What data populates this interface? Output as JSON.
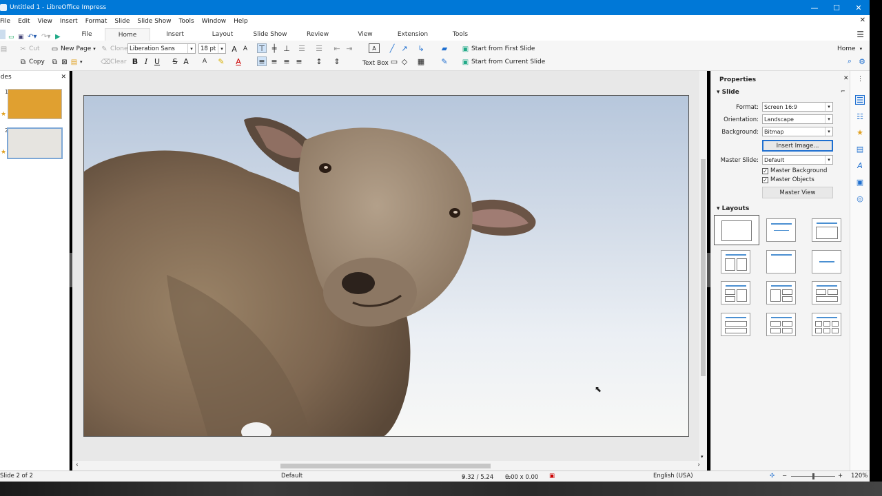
{
  "window": {
    "title": "Untitled 1 - LibreOffice Impress",
    "min": "—",
    "max": "☐",
    "close": "✕"
  },
  "menu": [
    "File",
    "Edit",
    "View",
    "Insert",
    "Format",
    "Slide",
    "Slide Show",
    "Tools",
    "Window",
    "Help"
  ],
  "menu_close": "✕",
  "tabs": [
    {
      "label": "File"
    },
    {
      "label": "Home"
    },
    {
      "label": "Insert"
    },
    {
      "label": "Layout"
    },
    {
      "label": "Slide Show"
    },
    {
      "label": "Review"
    },
    {
      "label": "View"
    },
    {
      "label": "Extension"
    },
    {
      "label": "Tools"
    }
  ],
  "toolbar": {
    "cut": "Cut",
    "copy": "Copy",
    "new_page": "New Page",
    "clone": "Clone",
    "clear": "Clear",
    "font_name": "Liberation Sans",
    "font_size": "18 pt",
    "text_box": "Text Box",
    "start_first": "Start from First Slide",
    "start_current": "Start from Current Slide",
    "home_dd": "Home",
    "bold": "B",
    "italic": "I",
    "underline": "U",
    "strike": "S",
    "shadow": "A",
    "font_color": "A",
    "grow": "A",
    "shrink": "A",
    "case": "A"
  },
  "slides_pane": {
    "title": "Slides",
    "items": [
      {
        "num": "1",
        "color": "#e0a030"
      },
      {
        "num": "2",
        "color": "#e6e6e6"
      }
    ]
  },
  "sidebar": {
    "title": "Properties",
    "slide_section": "Slide",
    "format_label": "Format:",
    "format_value": "Screen 16:9",
    "orientation_label": "Orientation:",
    "orientation_value": "Landscape",
    "background_label": "Background:",
    "background_value": "Bitmap",
    "insert_image": "Insert Image...",
    "master_label": "Master Slide:",
    "master_value": "Default",
    "master_background": "Master Background",
    "master_objects": "Master Objects",
    "master_view": "Master View",
    "layouts_section": "Layouts"
  },
  "status": {
    "slide_of": "Slide 2 of 2",
    "master": "Default",
    "position": "9.32 / 5.24",
    "size": "0.00 x 0.00",
    "language": "English (USA)",
    "zoom": "120%"
  },
  "icons": {
    "undo": "undo-icon",
    "redo": "redo-icon",
    "save": "save-icon",
    "open": "open-icon"
  }
}
